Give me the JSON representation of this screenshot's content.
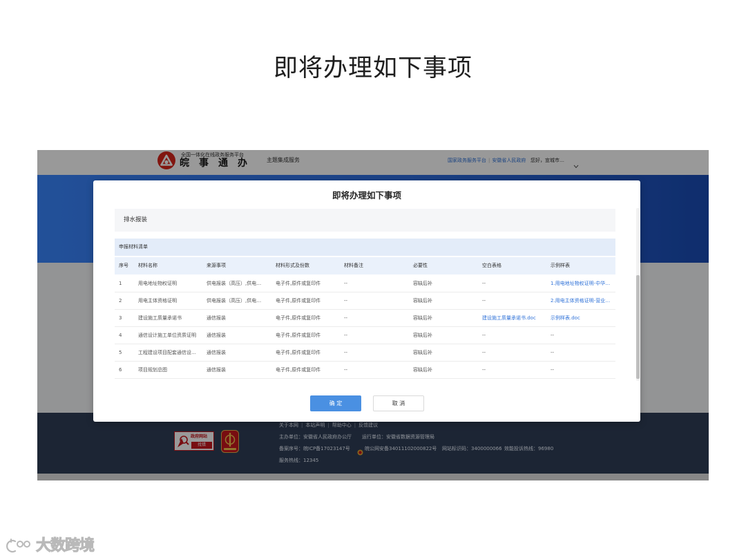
{
  "theme": {
    "primary": "#4a90e2",
    "link": "#2f72d8",
    "brand_red": "#d8261c"
  },
  "slide": {
    "title": "即将办理如下事项"
  },
  "site": {
    "header": {
      "logo_icon": "wan-shi-tong-logo-icon",
      "logo_subtitle": "全国一体化在线政务服务平台",
      "logo_title": "皖事通办",
      "nav_label": "主题集成服务",
      "portal_links": [
        "国家政务服务平台",
        "安徽省人民政府"
      ],
      "separator": "|",
      "greeting": "您好，宣城市…",
      "dropdown_icon": "chevron-down-icon"
    },
    "footer": {
      "links": [
        "关于本网",
        "本站声明",
        "帮助中心",
        "反馈建议"
      ],
      "separator": "|",
      "sponsor": "主办单位：安徽省人民政府办公厅",
      "operator": "运行单位：安徽省数据资源管理局",
      "icp": "备案序号：皖ICP备17023147号",
      "police_icon": "police-badge-icon",
      "police_record": "皖公网安备34011102000822号",
      "site_code": "网站标识码：3400000066",
      "complaint_hotline": "效能投诉热线：96980",
      "service_hotline": "服务热线：12345",
      "gov_badge": {
        "top": "政府网站",
        "bottom": "找错"
      },
      "emblem_icon": "party-government-emblem-icon"
    }
  },
  "modal": {
    "title": "即将办理如下事项",
    "item_name": "排水报装",
    "section_title": "申报材料清单",
    "columns": [
      "序号",
      "材料名称",
      "来源事项",
      "材料形式及份数",
      "材料备注",
      "必要性",
      "空白表格",
      "示例样表"
    ],
    "rows": [
      {
        "no": "1",
        "name": "用电地址物权证明",
        "source": "供电报装（高压）,供电…",
        "form": "电子件,原件或复印件",
        "note": "--",
        "necessity": "容缺后补",
        "blank": "--",
        "sample": "1.用电地址物权证明-中华…"
      },
      {
        "no": "2",
        "name": "用电主体资格证明",
        "source": "供电报装（高压）,供电…",
        "form": "电子件,原件或复印件",
        "note": "--",
        "necessity": "容缺后补",
        "blank": "--",
        "sample": "2.用电主体资格证明-营业…"
      },
      {
        "no": "3",
        "name": "建设施工质量承诺书",
        "source": "通信报装",
        "form": "电子件,原件或复印件",
        "note": "--",
        "necessity": "容缺后补",
        "blank": "建设施工质量承诺书.doc",
        "sample": "示例样表.doc"
      },
      {
        "no": "4",
        "name": "通信设计施工单位资质证明",
        "source": "通信报装",
        "form": "电子件,原件或复印件",
        "note": "--",
        "necessity": "容缺后补",
        "blank": "--",
        "sample": "--"
      },
      {
        "no": "5",
        "name": "工程建设项目配套通信设…",
        "source": "通信报装",
        "form": "电子件,原件或复印件",
        "note": "--",
        "necessity": "容缺后补",
        "blank": "--",
        "sample": "--"
      },
      {
        "no": "6",
        "name": "项目规划总图",
        "source": "通信报装",
        "form": "电子件,原件或复印件",
        "note": "--",
        "necessity": "容缺后补",
        "blank": "--",
        "sample": "--"
      }
    ],
    "confirm_label": "确 定",
    "cancel_label": "取 消"
  },
  "watermark": {
    "icon": "dashu-kuajing-logo-icon",
    "text": "大数跨境"
  }
}
